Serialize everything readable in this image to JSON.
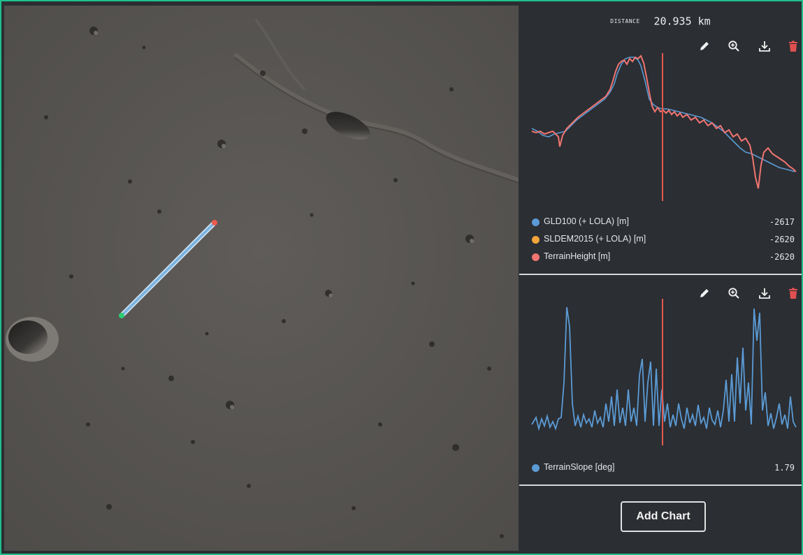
{
  "distance": {
    "label": "DISTANCE",
    "value": "20.935 km"
  },
  "toolbar_icons": [
    "pencil-icon",
    "zoom-in-icon",
    "download-icon",
    "trash-icon"
  ],
  "elevation_chart": {
    "legend": [
      {
        "name": "GLD100 (+ LOLA) [m]",
        "value": "-2617",
        "color": "#5b9bd5"
      },
      {
        "name": "SLDEM2015 (+ LOLA) [m]",
        "value": "-2620",
        "color": "#f2a43a"
      },
      {
        "name": "TerrainHeight [m]",
        "value": "-2620",
        "color": "#f07470"
      }
    ]
  },
  "slope_chart": {
    "legend": [
      {
        "name": "TerrainSlope [deg]",
        "value": "1.79",
        "color": "#5b9bd5"
      }
    ]
  },
  "add_chart_label": "Add Chart",
  "colors": {
    "accent_border": "#1fc08e",
    "panel_bg": "#2b2e33",
    "cursor_line": "#e0584e",
    "delete": "#e05050"
  }
}
